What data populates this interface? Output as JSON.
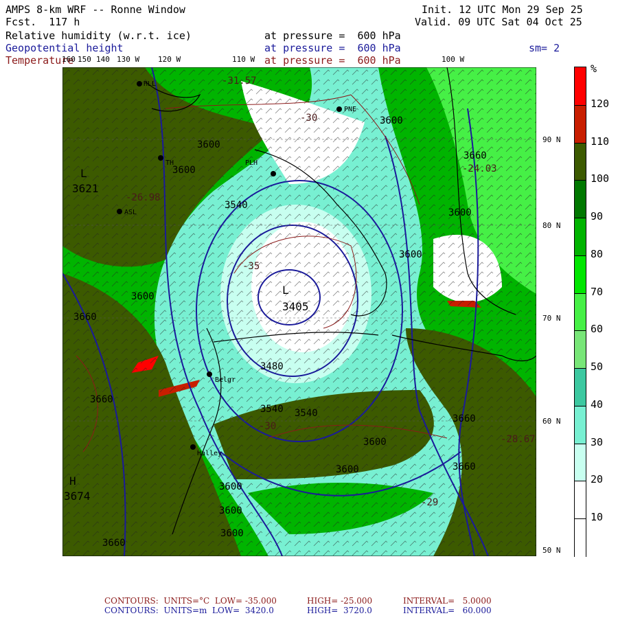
{
  "header": {
    "title": "AMPS 8-km WRF -- Ronne Window",
    "fcst": "Fcst.  117 h",
    "init": "Init. 12 UTC Mon 29 Sep 25",
    "valid": "Valid. 09 UTC Sat 04 Oct 25",
    "field1": "Relative humidity (w.r.t. ice)",
    "field2": "Geopotential height",
    "field3": "Temperature",
    "pressure1": "at pressure =  600 hPa",
    "pressure2": "at pressure =  600 hPa",
    "pressure3": "at pressure =  600 hPa",
    "smoothing": "sm= 2"
  },
  "lon_labels": [
    "160",
    "150",
    "140",
    "130 W",
    "120 W",
    "110 W",
    "100 W"
  ],
  "lat_labels": [
    "90 N",
    "80 N",
    "70 N",
    "60 N",
    "50 N"
  ],
  "colorbar": {
    "unit": "%",
    "ticks": [
      "120",
      "110",
      "100",
      "90",
      "80",
      "70",
      "60",
      "50",
      "40",
      "30",
      "20",
      "10"
    ],
    "colors": [
      "#ff0000",
      "#c81e00",
      "#3c5a00",
      "#007800",
      "#00b400",
      "#00e600",
      "#46f046",
      "#78e678",
      "#3cc8a0",
      "#78f0d2",
      "#c8fff0",
      "#ffffff",
      "#ffffff"
    ]
  },
  "map_labels": {
    "height_contours": [
      "3600",
      "3600",
      "3600",
      "3540",
      "3600",
      "3660",
      "3660",
      "3600",
      "3600",
      "3660",
      "3480",
      "3540",
      "3540",
      "3600",
      "3600",
      "3600",
      "3660",
      "3660",
      "3600",
      "3600",
      "3660"
    ],
    "low_center": "L",
    "low_value": "3405",
    "low_center_2": "L",
    "low_value_2": "3621",
    "high_center": "H",
    "high_value": "3674",
    "temps": [
      "-31.57",
      "-26.98",
      "-24.03",
      "-28.67",
      "-29",
      "-35",
      "-30",
      "-30"
    ],
    "stations": [
      "HLL",
      "TH",
      "PLH",
      "PNE",
      "Belgr",
      "Halley",
      "ASL"
    ]
  },
  "footer": {
    "line1_label": "CONTOURS:  UNITS=°C  LOW= -35.000",
    "line1_high": "HIGH= -25.000",
    "line1_interval": "INTERVAL=   5.0000",
    "line2_label": "CONTOURS:  UNITS=m  LOW=  3420.0",
    "line2_high": "HIGH=  3720.0",
    "line2_interval": "INTERVAL=   60.000"
  }
}
